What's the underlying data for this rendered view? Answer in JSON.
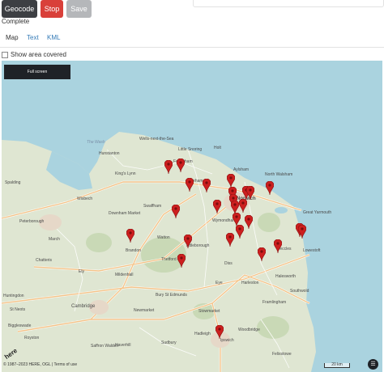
{
  "toolbar": {
    "geocode_label": "Geocode",
    "stop_label": "Stop",
    "save_label": "Save",
    "geocode_color": "#3d3f43",
    "stop_color": "#d9403a",
    "save_color": "#b5b7ba"
  },
  "status_text": "Complete",
  "tabs": [
    {
      "label": "Map",
      "active": true
    },
    {
      "label": "Text",
      "active": false
    },
    {
      "label": "KML",
      "active": false
    }
  ],
  "show_area": {
    "label": "Show area covered",
    "checked": false
  },
  "map": {
    "fullscreen_label": "Full screen",
    "marker_color": "#cc1f1f",
    "marker_icon": "map-pin-icon",
    "marker_count": 26,
    "place_labels": [
      "The Wash",
      "King's Lynn",
      "Wisbech",
      "Downham Market",
      "Swaffham",
      "Dereham",
      "Norwich",
      "Wymondham",
      "Attleborough",
      "Great Yarmouth",
      "Lowestoft",
      "Thetford",
      "Brandon",
      "Peterborough",
      "Huntingdon",
      "Cambridge",
      "Bury St Edmunds",
      "Newmarket",
      "Stowmarket",
      "Ipswich",
      "Woodbridge",
      "Haverhill",
      "Sudbury",
      "Halesworth",
      "Beccles",
      "Diss",
      "Framlingham",
      "Hunstanton",
      "Fakenham",
      "Little Snoring",
      "Holt",
      "Aylsham",
      "North Walsham",
      "Wells-next-the-Sea",
      "Spalding",
      "March",
      "Chatteris",
      "Ely",
      "Mildenhall",
      "Saffron Walden",
      "Royston",
      "Biggleswade",
      "St Neots",
      "Hadleigh",
      "Felixstowe",
      "Southwold",
      "Harleston",
      "Eye",
      "Watton"
    ],
    "attribution": "© 1987–2023 HERE, OGL | Terms of use",
    "here_logo": "here",
    "scale_label": "20 km",
    "layers_icon": "layers-icon"
  }
}
